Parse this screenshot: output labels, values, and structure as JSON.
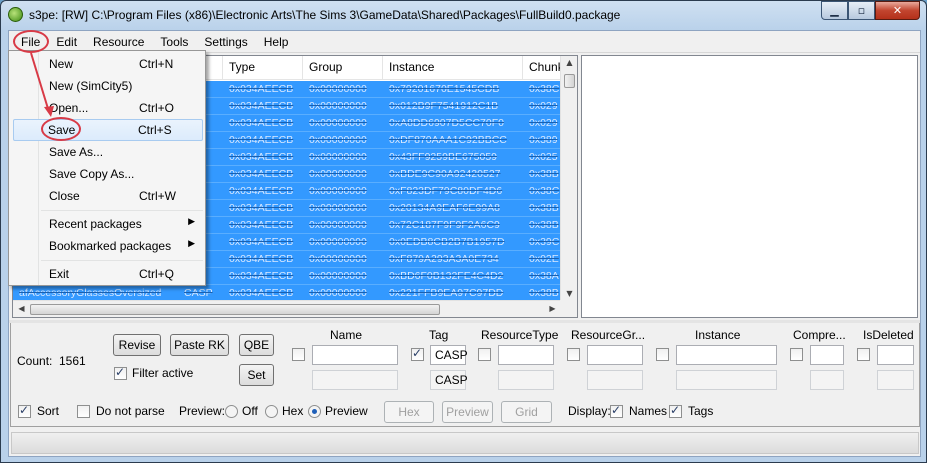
{
  "window": {
    "title": "s3pe: [RW] C:\\Program Files (x86)\\Electronic Arts\\The Sims 3\\GameData\\Shared\\Packages\\FullBuild0.package",
    "min_glyph": "▁",
    "max_glyph": "▫",
    "close_glyph": "✕"
  },
  "menubar": {
    "file": "File",
    "edit": "Edit",
    "resource": "Resource",
    "tools": "Tools",
    "settings": "Settings",
    "help": "Help"
  },
  "file_menu": {
    "items": [
      {
        "label": "New",
        "shortcut": "Ctrl+N"
      },
      {
        "label": "New (SimCity5)",
        "shortcut": ""
      },
      {
        "label": "Open...",
        "shortcut": "Ctrl+O"
      },
      {
        "label": "Save",
        "shortcut": "Ctrl+S"
      },
      {
        "label": "Save As...",
        "shortcut": ""
      },
      {
        "label": "Save Copy As...",
        "shortcut": ""
      },
      {
        "label": "Close",
        "shortcut": "Ctrl+W"
      },
      {
        "label": "Recent packages",
        "shortcut": ""
      },
      {
        "label": "Bookmarked packages",
        "shortcut": ""
      },
      {
        "label": "Exit",
        "shortcut": "Ctrl+Q"
      }
    ],
    "submenu_arrow": "▶"
  },
  "grid": {
    "columns": [
      "Type",
      "Group",
      "Instance",
      "Chunk"
    ],
    "rows": [
      {
        "name": "",
        "tag": "",
        "type": "0x034AEECB",
        "group": "0x00000000",
        "instance": "0x79201670E1545CDB",
        "chunk": "0x38C"
      },
      {
        "name": "",
        "tag": "",
        "type": "0x034AEECB",
        "group": "0x00000000",
        "instance": "0x012B9F7541912C1B",
        "chunk": "0x029"
      },
      {
        "name": "",
        "tag": "",
        "type": "0x034AEECB",
        "group": "0x00000000",
        "instance": "0xA8DD6907D5CC70F0",
        "chunk": "0x029"
      },
      {
        "name": "",
        "tag": "",
        "type": "0x034AEECB",
        "group": "0x00000000",
        "instance": "0xDF870AAA1C92BBCC",
        "chunk": "0x389"
      },
      {
        "name": "",
        "tag": "",
        "type": "0x034AEECB",
        "group": "0x00000000",
        "instance": "0x43FF9259BE675059",
        "chunk": "0x025"
      },
      {
        "name": "",
        "tag": "",
        "type": "0x034AEECB",
        "group": "0x00000000",
        "instance": "0xBDE9C90A92420527",
        "chunk": "0x38B"
      },
      {
        "name": "",
        "tag": "",
        "type": "0x034AEECB",
        "group": "0x00000000",
        "instance": "0xF823DF79C80DF4D6",
        "chunk": "0x38C"
      },
      {
        "name": "",
        "tag": "",
        "type": "0x034AEECB",
        "group": "0x00000000",
        "instance": "0x20134A9EAF6E99A8",
        "chunk": "0x38B"
      },
      {
        "name": "",
        "tag": "",
        "type": "0x034AEECB",
        "group": "0x00000000",
        "instance": "0x72C187F9F9F2A6C9",
        "chunk": "0x38B"
      },
      {
        "name": "",
        "tag": "",
        "type": "0x034AEECB",
        "group": "0x00000000",
        "instance": "0x0EDB8CB2B7B1957D",
        "chunk": "0x39C"
      },
      {
        "name": "",
        "tag": "",
        "type": "0x034AEECB",
        "group": "0x00000000",
        "instance": "0xF879A293A3A0E734",
        "chunk": "0x02E"
      },
      {
        "name": "",
        "tag": "",
        "type": "0x034AEECB",
        "group": "0x00000000",
        "instance": "0xBD6F0B132FE4C4D2",
        "chunk": "0x38A"
      },
      {
        "name": "afAccessoryGlassesOversized",
        "tag": "CASP",
        "type": "0x034AEECB",
        "group": "0x00000000",
        "instance": "0x221FFB9EA97C97DD",
        "chunk": "0x38B"
      }
    ]
  },
  "filter": {
    "count_label": "Count:",
    "count_value": "1561",
    "revise": "Revise",
    "paste_rk": "Paste RK",
    "qbe": "QBE",
    "set": "Set",
    "filter_active": "Filter active",
    "headers": {
      "name": "Name",
      "tag": "Tag",
      "resource_type": "ResourceType",
      "resource_group": "ResourceGr...",
      "instance": "Instance",
      "compressed": "Compre...",
      "is_deleted": "IsDeleted"
    },
    "tag_value": "CASP",
    "tag_value2": "CASP"
  },
  "bottom": {
    "sort": "Sort",
    "do_not_parse": "Do not parse",
    "preview_label": "Preview:",
    "off": "Off",
    "hex": "Hex",
    "preview": "Preview",
    "hex_btn": "Hex",
    "preview_btn": "Preview",
    "grid_btn": "Grid",
    "display_label": "Display:",
    "names": "Names",
    "tags": "Tags"
  },
  "colors": {
    "selection": "#3399ff",
    "annotation": "#d83a46"
  }
}
